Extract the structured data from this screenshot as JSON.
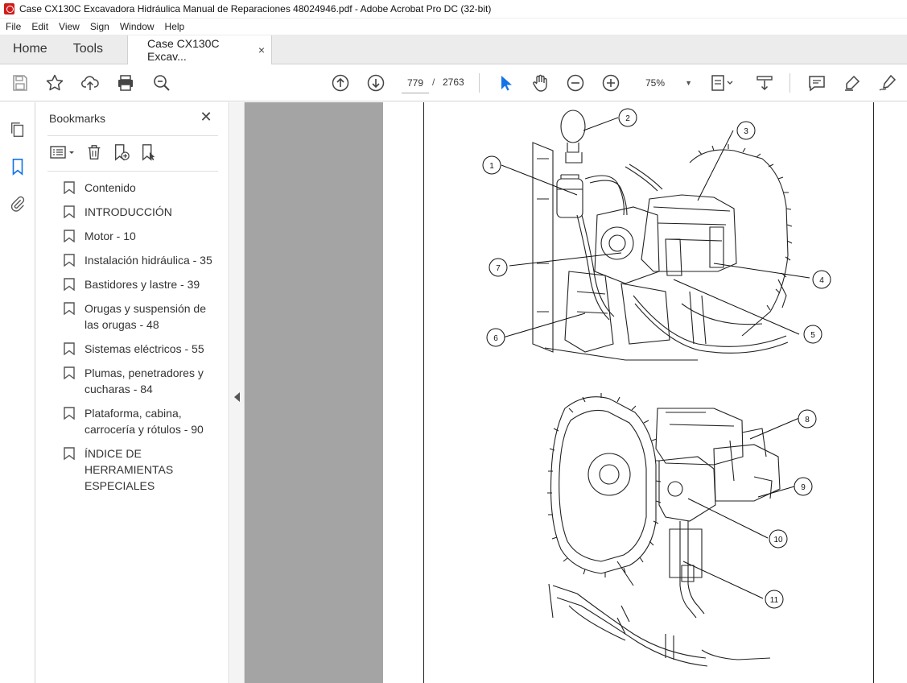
{
  "window": {
    "title": "Case CX130C Excavadora Hidráulica Manual de Reparaciones 48024946.pdf - Adobe Acrobat Pro DC (32-bit)"
  },
  "menu": [
    "File",
    "Edit",
    "View",
    "Sign",
    "Window",
    "Help"
  ],
  "tabs": {
    "home": "Home",
    "tools": "Tools",
    "document": "Case CX130C Excav...",
    "close_glyph": "×"
  },
  "toolbar": {
    "current_page": "779",
    "page_separator": "/",
    "total_pages": "2763",
    "zoom": "75%",
    "icons": [
      "save-icon",
      "star-icon",
      "upload-icon",
      "print-icon",
      "search-zoom-icon",
      "page-up-icon",
      "page-down-icon",
      "select-cursor-icon",
      "hand-icon",
      "zoom-out-icon",
      "zoom-in-icon",
      "page-fit-icon",
      "scroll-mode-icon",
      "comment-icon",
      "highlight-icon",
      "sign-icon"
    ]
  },
  "bookmarks": {
    "title": "Bookmarks",
    "close_glyph": "✕",
    "items": [
      "Contenido",
      "INTRODUCCIÓN",
      "Motor - 10",
      "Instalación hidráulica - 35",
      "Bastidores y lastre - 39",
      "Orugas y suspensión de las orugas - 48",
      "Sistemas eléctricos - 55",
      "Plumas, penetradores y cucharas - 84",
      "Plataforma, cabina, carrocería y rótulos - 90",
      "ÍNDICE DE HERRAMIENTAS ESPECIALES"
    ]
  },
  "figure": {
    "callouts_top": [
      "1",
      "2",
      "3",
      "4",
      "5",
      "6",
      "7"
    ],
    "callouts_bottom": [
      "8",
      "9",
      "10",
      "11"
    ]
  },
  "colors": {
    "accent_blue": "#1473e6",
    "page_gray": "#a4a4a4",
    "acrobat_red": "#d11c1c"
  }
}
